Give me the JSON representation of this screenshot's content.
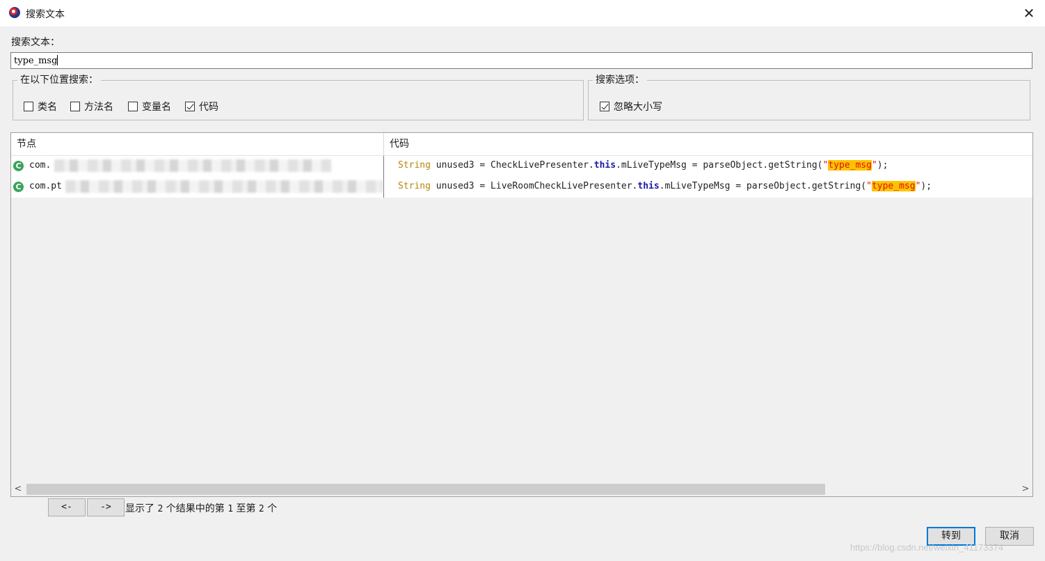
{
  "window": {
    "title": "搜索文本",
    "close_glyph": "✕"
  },
  "search": {
    "label": "搜索文本：",
    "value": "type_msg"
  },
  "locations": {
    "title": "在以下位置搜索：",
    "options": [
      {
        "label": "类名",
        "checked": false
      },
      {
        "label": "方法名",
        "checked": false
      },
      {
        "label": "变量名",
        "checked": false
      },
      {
        "label": "代码",
        "checked": true
      }
    ]
  },
  "search_options": {
    "title": "搜索选项：",
    "ignore_case": {
      "label": "忽略大小写",
      "checked": true
    }
  },
  "results": {
    "columns": [
      "节点",
      "代码"
    ],
    "rows": [
      {
        "node": "com.",
        "icon": "class-icon",
        "code_type": "String",
        "code_a": " unused3 = CheckLivePresenter.",
        "code_this": "this",
        "code_b": ".mLiveTypeMsg = parseObject.getString(",
        "code_q1": "\"",
        "code_match": "type_msg",
        "code_q2": "\"",
        "code_end": ");"
      },
      {
        "node": "com.pt",
        "icon": "class-icon",
        "code_type": "String",
        "code_a": " unused3 = LiveRoomCheckLivePresenter.",
        "code_this": "this",
        "code_b": ".mLiveTypeMsg = parseObject.getString(",
        "code_q1": "\"",
        "code_match": "type_msg",
        "code_q2": "\"",
        "code_end": ");"
      }
    ]
  },
  "navigation": {
    "prev_label": "<-",
    "next_label": "->",
    "status_parts": [
      "显示了",
      "2",
      "个结果中的第",
      "1",
      "至第",
      "2",
      "个"
    ]
  },
  "buttons": {
    "goto": "转到",
    "cancel": "取消"
  },
  "watermark": "https://blog.csdn.net/weixin_41173374",
  "colors": {
    "highlight": "#ffc300",
    "keyword_this": "#1a1aa6",
    "type": "#b8860b",
    "string": "#dd1111"
  }
}
